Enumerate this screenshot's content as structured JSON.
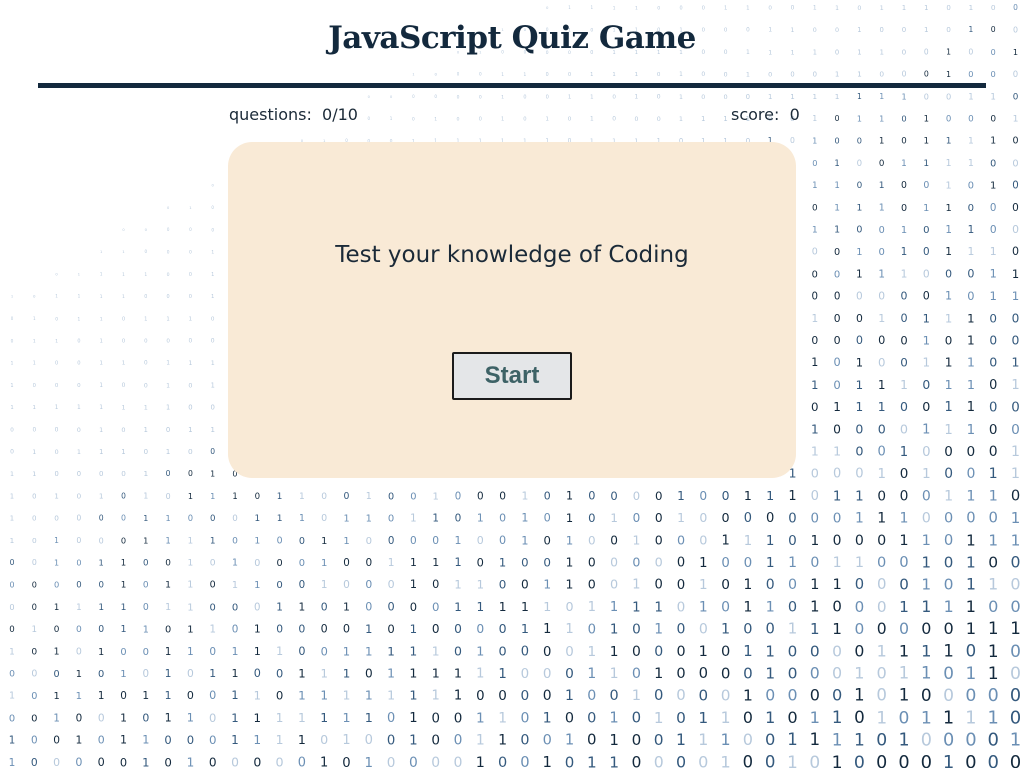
{
  "header": {
    "title": "JavaScript Quiz Game"
  },
  "stats": {
    "questions_label": "questions:",
    "questions_value": "0/10",
    "score_label": "score:",
    "score_value": "0"
  },
  "card": {
    "prompt": "Test your knowledge of Coding",
    "start_label": "Start"
  },
  "background": {
    "pattern": "binary digits 0 and 1",
    "colors": [
      "#13293d",
      "#34597d",
      "#6b8fb4",
      "#b7c9dc"
    ]
  }
}
